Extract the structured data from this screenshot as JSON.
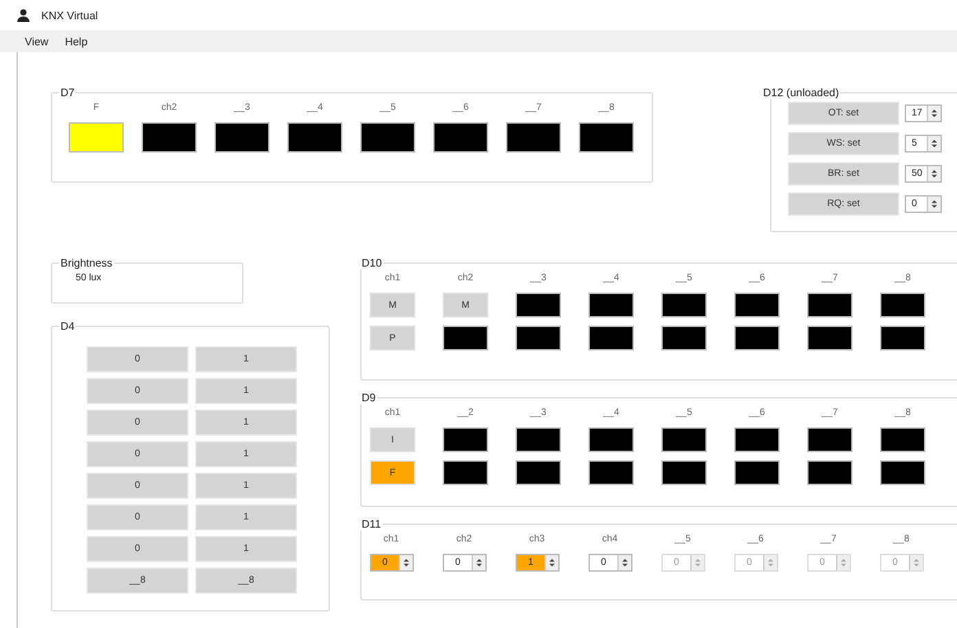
{
  "window": {
    "title": "KNX Virtual"
  },
  "menu": [
    {
      "label": "View"
    },
    {
      "label": "Help"
    }
  ],
  "d7": {
    "title": "D7",
    "channels": [
      {
        "label": "F",
        "color": "#ffff00"
      },
      {
        "label": "ch2",
        "color": "#000000"
      },
      {
        "label": "__3",
        "color": "#000000"
      },
      {
        "label": "__4",
        "color": "#000000"
      },
      {
        "label": "__5",
        "color": "#000000"
      },
      {
        "label": "__6",
        "color": "#000000"
      },
      {
        "label": "__7",
        "color": "#000000"
      },
      {
        "label": "__8",
        "color": "#000000"
      }
    ]
  },
  "d12": {
    "title": "D12 (unloaded)",
    "rows": [
      {
        "button": "OT: set",
        "value": "17"
      },
      {
        "button": "WS: set",
        "value": "5"
      },
      {
        "button": "BR: set",
        "value": "50"
      },
      {
        "button": "RQ: set",
        "value": "0"
      }
    ]
  },
  "brightness": {
    "title": "Brightness",
    "reading": "50 lux"
  },
  "d4": {
    "title": "D4",
    "rows": [
      {
        "off": "0",
        "on": "1"
      },
      {
        "off": "0",
        "on": "1"
      },
      {
        "off": "0",
        "on": "1"
      },
      {
        "off": "0",
        "on": "1"
      },
      {
        "off": "0",
        "on": "1"
      },
      {
        "off": "0",
        "on": "1"
      },
      {
        "off": "0",
        "on": "1"
      },
      {
        "off": "__8",
        "on": "__8"
      }
    ]
  },
  "d10": {
    "title": "D10",
    "channels": [
      {
        "label": "ch1",
        "cells": [
          {
            "kind": "button",
            "text": "M",
            "color": "#d4d4d4"
          },
          {
            "kind": "button",
            "text": "P",
            "color": "#d4d4d4"
          }
        ]
      },
      {
        "label": "ch2",
        "cells": [
          {
            "kind": "button",
            "text": "M",
            "color": "#d4d4d4"
          },
          {
            "kind": "lamp",
            "color": "#000000"
          }
        ]
      },
      {
        "label": "__3",
        "cells": [
          {
            "kind": "lamp",
            "color": "#000000"
          },
          {
            "kind": "lamp",
            "color": "#000000"
          }
        ]
      },
      {
        "label": "__4",
        "cells": [
          {
            "kind": "lamp",
            "color": "#000000"
          },
          {
            "kind": "lamp",
            "color": "#000000"
          }
        ]
      },
      {
        "label": "__5",
        "cells": [
          {
            "kind": "lamp",
            "color": "#000000"
          },
          {
            "kind": "lamp",
            "color": "#000000"
          }
        ]
      },
      {
        "label": "__6",
        "cells": [
          {
            "kind": "lamp",
            "color": "#000000"
          },
          {
            "kind": "lamp",
            "color": "#000000"
          }
        ]
      },
      {
        "label": "__7",
        "cells": [
          {
            "kind": "lamp",
            "color": "#000000"
          },
          {
            "kind": "lamp",
            "color": "#000000"
          }
        ]
      },
      {
        "label": "__8",
        "cells": [
          {
            "kind": "lamp",
            "color": "#000000"
          },
          {
            "kind": "lamp",
            "color": "#000000"
          }
        ]
      }
    ]
  },
  "d9": {
    "title": "D9",
    "channels": [
      {
        "label": "ch1",
        "cells": [
          {
            "kind": "button",
            "text": "I",
            "color": "#d4d4d4"
          },
          {
            "kind": "button",
            "text": "F",
            "color": "#ffa500"
          }
        ]
      },
      {
        "label": "__2",
        "cells": [
          {
            "kind": "lamp",
            "color": "#000000"
          },
          {
            "kind": "lamp",
            "color": "#000000"
          }
        ]
      },
      {
        "label": "__3",
        "cells": [
          {
            "kind": "lamp",
            "color": "#000000"
          },
          {
            "kind": "lamp",
            "color": "#000000"
          }
        ]
      },
      {
        "label": "__4",
        "cells": [
          {
            "kind": "lamp",
            "color": "#000000"
          },
          {
            "kind": "lamp",
            "color": "#000000"
          }
        ]
      },
      {
        "label": "__5",
        "cells": [
          {
            "kind": "lamp",
            "color": "#000000"
          },
          {
            "kind": "lamp",
            "color": "#000000"
          }
        ]
      },
      {
        "label": "__6",
        "cells": [
          {
            "kind": "lamp",
            "color": "#000000"
          },
          {
            "kind": "lamp",
            "color": "#000000"
          }
        ]
      },
      {
        "label": "__7",
        "cells": [
          {
            "kind": "lamp",
            "color": "#000000"
          },
          {
            "kind": "lamp",
            "color": "#000000"
          }
        ]
      },
      {
        "label": "__8",
        "cells": [
          {
            "kind": "lamp",
            "color": "#000000"
          },
          {
            "kind": "lamp",
            "color": "#000000"
          }
        ]
      }
    ]
  },
  "d11": {
    "title": "D11",
    "channels": [
      {
        "label": "ch1",
        "value": "0",
        "active": true,
        "disabled": false
      },
      {
        "label": "ch2",
        "value": "0",
        "active": false,
        "disabled": false
      },
      {
        "label": "ch3",
        "value": "1",
        "active": true,
        "disabled": false
      },
      {
        "label": "ch4",
        "value": "0",
        "active": false,
        "disabled": false
      },
      {
        "label": "__5",
        "value": "0",
        "active": false,
        "disabled": true
      },
      {
        "label": "__6",
        "value": "0",
        "active": false,
        "disabled": true
      },
      {
        "label": "__7",
        "value": "0",
        "active": false,
        "disabled": true
      },
      {
        "label": "__8",
        "value": "0",
        "active": false,
        "disabled": true
      }
    ]
  }
}
